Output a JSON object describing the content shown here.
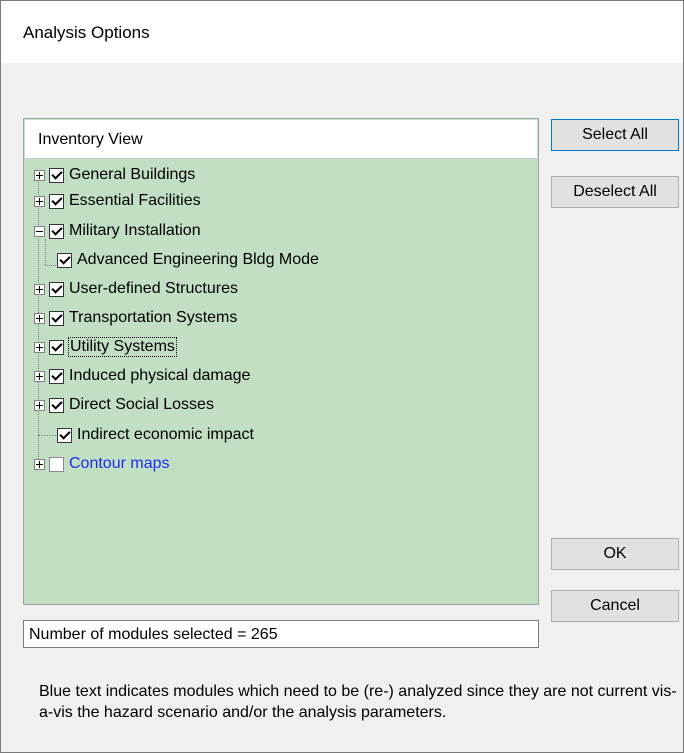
{
  "window": {
    "title": "Analysis Options"
  },
  "tree": {
    "header": "Inventory View",
    "items": [
      {
        "label": "General Buildings",
        "checked": true,
        "expander": "plus"
      },
      {
        "label": "Essential Facilities",
        "checked": true,
        "expander": "plus"
      },
      {
        "label": "Military Installation",
        "checked": true,
        "expander": "minus"
      },
      {
        "label": "Advanced Engineering Bldg Mode",
        "checked": true,
        "expander": "none"
      },
      {
        "label": "User-defined Structures",
        "checked": true,
        "expander": "plus"
      },
      {
        "label": "Transportation Systems",
        "checked": true,
        "expander": "plus"
      },
      {
        "label": "Utility Systems",
        "checked": true,
        "expander": "plus"
      },
      {
        "label": "Induced physical damage",
        "checked": true,
        "expander": "plus"
      },
      {
        "label": "Direct Social Losses",
        "checked": true,
        "expander": "plus"
      },
      {
        "label": "Indirect economic impact",
        "checked": true,
        "expander": "none"
      },
      {
        "label": "Contour maps",
        "checked": false,
        "expander": "plus",
        "color": "#1a2ee6"
      }
    ]
  },
  "buttons": {
    "select_all": "Select All",
    "deselect_all": "Deselect All",
    "ok": "OK",
    "cancel": "Cancel"
  },
  "status": "Number of modules selected = 265",
  "note": "Blue text indicates modules which need to be (re-) analyzed since they are not current vis-a-vis the hazard scenario and/or the analysis parameters."
}
